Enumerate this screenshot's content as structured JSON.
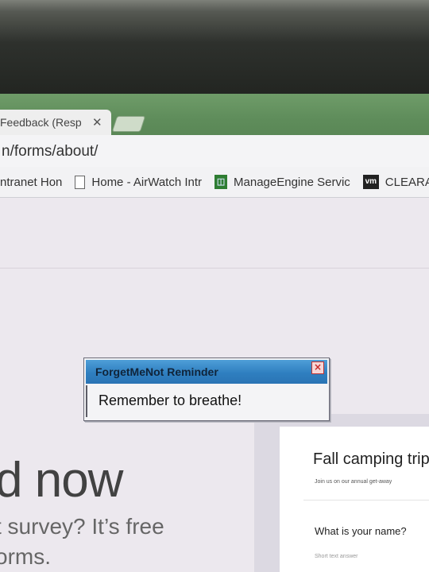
{
  "browser": {
    "tab": {
      "title": "Feedback (Resp",
      "close_glyph": "✕"
    },
    "address": "n/forms/about/",
    "bookmarks": [
      {
        "label": "ntranet Hon",
        "icon": "none"
      },
      {
        "label": "Home - AirWatch Intr",
        "icon": "page-icon"
      },
      {
        "label": "ManageEngine Servic",
        "icon": "manageengine-icon"
      },
      {
        "label": "CLEARA",
        "icon": "vm-icon",
        "icon_text": "vm"
      }
    ]
  },
  "page": {
    "hero": "d now",
    "sub_line1": "t survey? It’s free",
    "sub_line2": "orms."
  },
  "form_preview": {
    "title": "Fall camping trip",
    "description": "Join us on our annual get-away",
    "question": "What is your name?",
    "hint": "Short text answer"
  },
  "popup": {
    "title": "ForgetMeNot Reminder",
    "message": "Remember to breathe!",
    "close_glyph": "×"
  },
  "colors": {
    "tabstrip": "#6f9c69",
    "popup_titlebar": "#2f7fc0",
    "page_bg": "#ece8ee"
  }
}
